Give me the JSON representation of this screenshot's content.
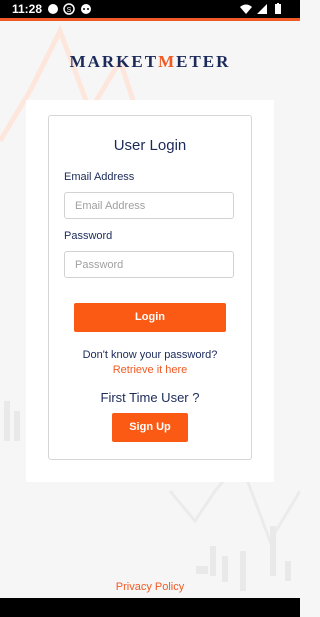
{
  "status_bar": {
    "time": "11:28",
    "icons": [
      "circle-icon",
      "s-icon",
      "face-icon",
      "wifi-icon",
      "signal-icon",
      "battery-icon"
    ]
  },
  "logo": {
    "part1": "MARKET",
    "part2": "M",
    "part3": "ETER"
  },
  "login_card": {
    "title": "User Login",
    "email_label": "Email Address",
    "email_placeholder": "Email Address",
    "password_label": "Password",
    "password_placeholder": "Password",
    "login_button": "Login",
    "forgot_text": "Don't know your password?",
    "retrieve_link": "Retrieve it here",
    "first_time": "First Time User ?",
    "signup_button": "Sign Up"
  },
  "footer": {
    "privacy_link": "Privacy Policy"
  },
  "colors": {
    "accent": "#f15a24",
    "brand_navy": "#1b2a5a"
  }
}
